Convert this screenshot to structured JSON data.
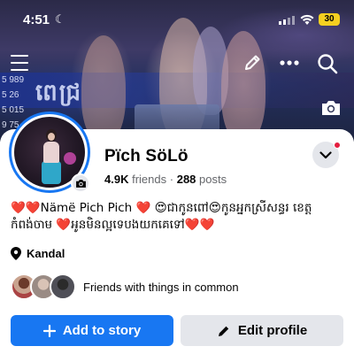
{
  "status_bar": {
    "time": "4:51",
    "moon_glyph": "☾",
    "battery": "30"
  },
  "cover": {
    "banner_text": "ពេជ្រ",
    "numbers": [
      "5 989",
      "5 26",
      "5 015",
      "9 75"
    ]
  },
  "profile": {
    "name": "Pïch SöLö",
    "friends_count": "4.9K",
    "friends_label": "friends",
    "separator": "·",
    "posts_count": "288",
    "posts_label": "posts",
    "bio": "❤️❤️Nämë Pich Pich ❤️ 😍ជាកូនពៅ😍កូនអ្នកស្រីសន្ធរ ខេត្តកំពង់ចាម ❤️អូនមិនល្អទេបងយកគេទៅ❤️❤️",
    "location": "Kandal",
    "mutual_text": "Friends with things in common"
  },
  "buttons": {
    "add_story": "Add to story",
    "edit_profile": "Edit profile"
  },
  "colors": {
    "accent": "#1877f2",
    "secondary_button": "#e4e6eb",
    "notification_dot": "#e41e3f",
    "battery": "#f5d020"
  },
  "icons": [
    "menu-icon",
    "pencil-icon",
    "more-icon",
    "search-icon",
    "camera-icon",
    "chevron-down-icon",
    "location-pin-icon",
    "plus-icon"
  ]
}
